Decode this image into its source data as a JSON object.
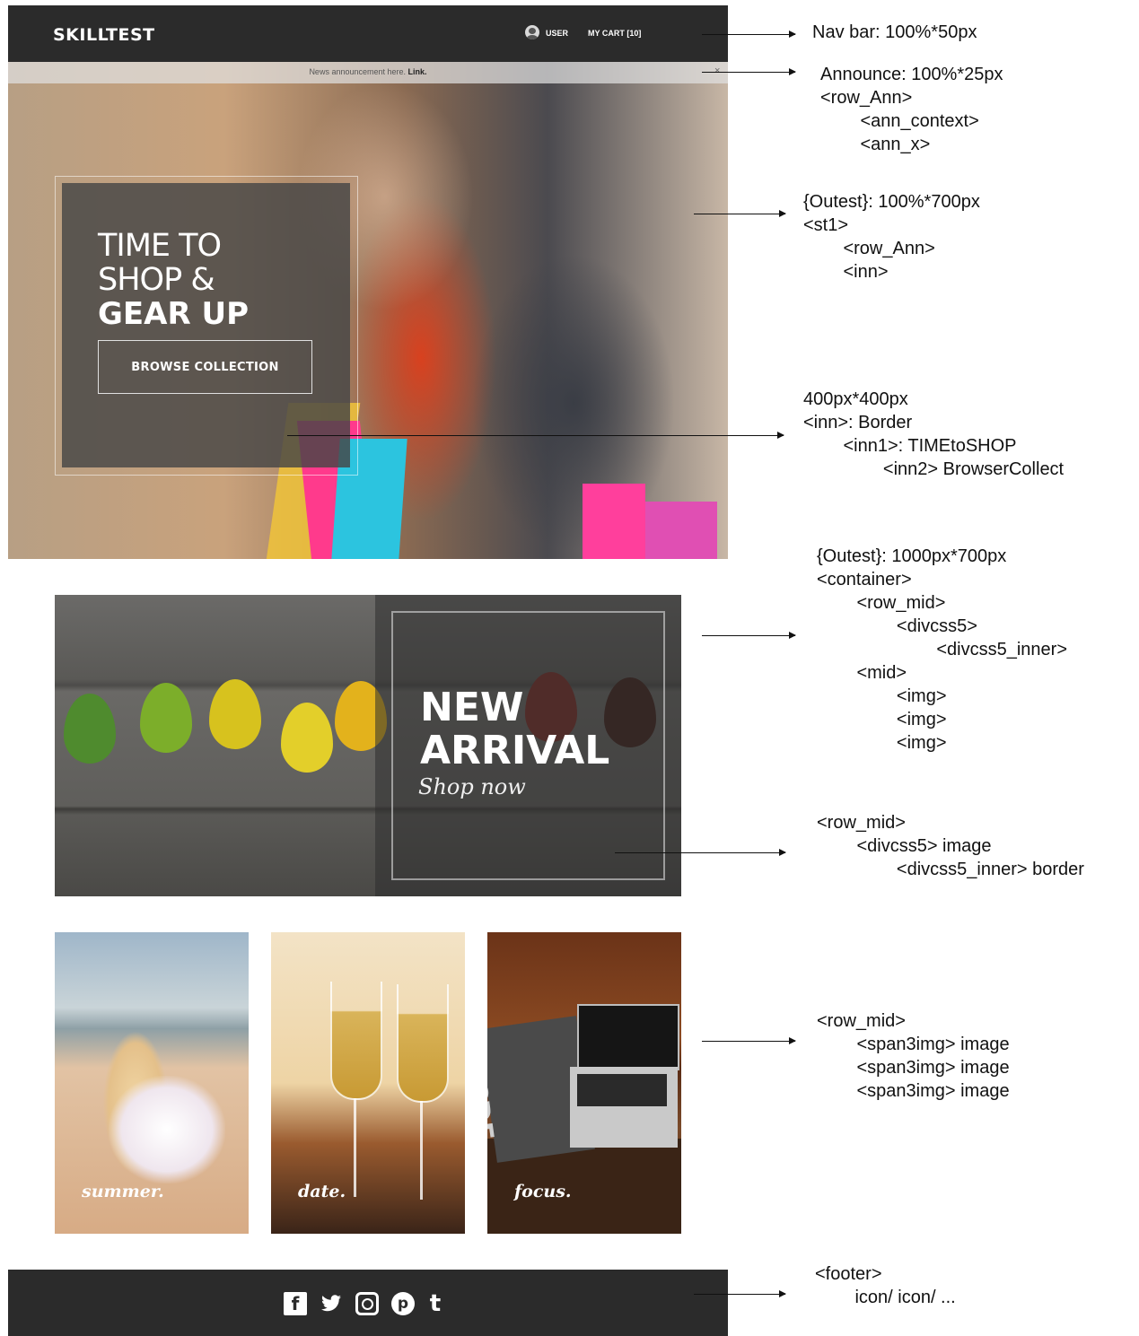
{
  "mockup": {
    "nav": {
      "brand": "SKILLTEST",
      "user_label": "USER",
      "cart_label": "MY CART [10]"
    },
    "announcement": {
      "text": "News announcement here.",
      "link": "Link.",
      "close": "×"
    },
    "hero": {
      "line1": "TIME TO",
      "line2": "SHOP &",
      "line3": "GEAR UP",
      "button": "BROWSE COLLECTION"
    },
    "arrival": {
      "line1": "NEW",
      "line2": "ARRIVAL",
      "subtitle": "Shop now"
    },
    "tiles": [
      {
        "caption": "summer."
      },
      {
        "caption": "date."
      },
      {
        "caption": "focus.",
        "pillow_text": "ABCDE\nFGHIJKL"
      }
    ],
    "footer_icons": [
      {
        "icon": "facebook-icon",
        "glyph": "f"
      },
      {
        "icon": "twitter-icon",
        "glyph": "🐦"
      },
      {
        "icon": "instagram-icon",
        "glyph": ""
      },
      {
        "icon": "pinterest-icon",
        "glyph": "p"
      },
      {
        "icon": "tumblr-icon",
        "glyph": "t"
      }
    ]
  },
  "annotations": [
    {
      "text": "Nav bar: 100%*50px"
    },
    {
      "text": "Announce: 100%*25px\n<row_Ann>\n        <ann_context>\n        <ann_x>"
    },
    {
      "text": "{Outest}: 100%*700px\n<st1>\n        <row_Ann>\n        <inn>"
    },
    {
      "text": "400px*400px\n<inn>: Border\n        <inn1>: TIMEtoSHOP\n                <inn2> BrowserCollect"
    },
    {
      "text": "{Outest}: 1000px*700px\n<container>\n        <row_mid>\n                <divcss5>\n                        <divcss5_inner>\n        <mid>\n                <img>\n                <img>\n                <img>"
    },
    {
      "text": "<row_mid>\n        <divcss5> image\n                <divcss5_inner> border"
    },
    {
      "text": "<row_mid>\n        <span3img> image\n        <span3img> image\n        <span3img> image"
    },
    {
      "text": "<footer>\n        icon/ icon/ ..."
    }
  ]
}
